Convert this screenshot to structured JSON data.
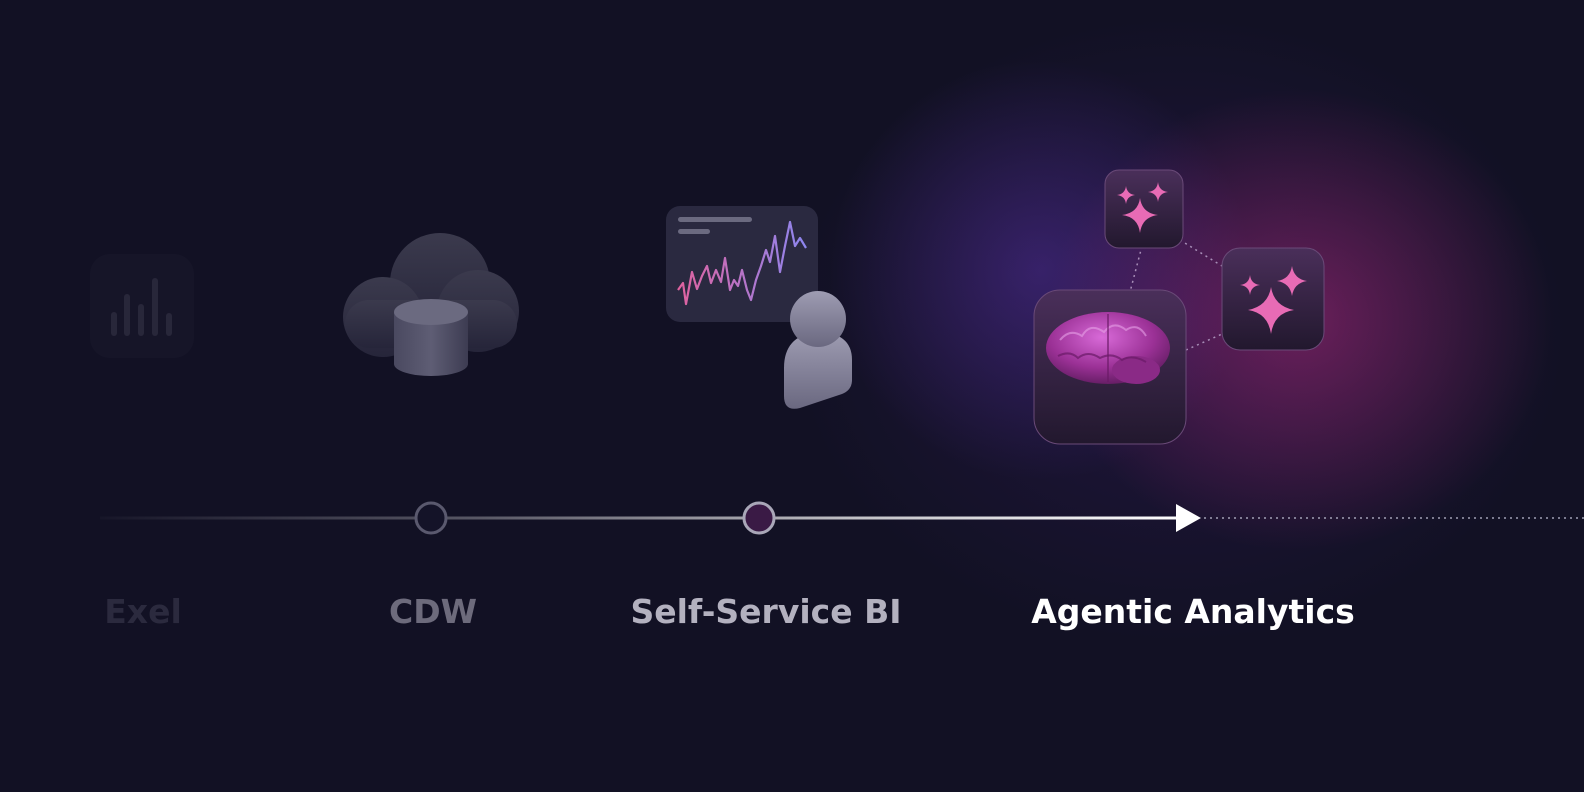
{
  "stages": [
    {
      "label": "Exel",
      "icon": "bar-chart-icon"
    },
    {
      "label": "CDW",
      "icon": "cloud-database-icon"
    },
    {
      "label": "Self-Service BI",
      "icon": "dashboard-user-icon"
    },
    {
      "label": "Agentic Analytics",
      "icon": "ai-brain-icon"
    }
  ],
  "colors": {
    "background": "#121124",
    "accent_pink": "#e86bb5",
    "accent_purple": "#8a7ee6",
    "node_fill": "#3a1a45"
  }
}
